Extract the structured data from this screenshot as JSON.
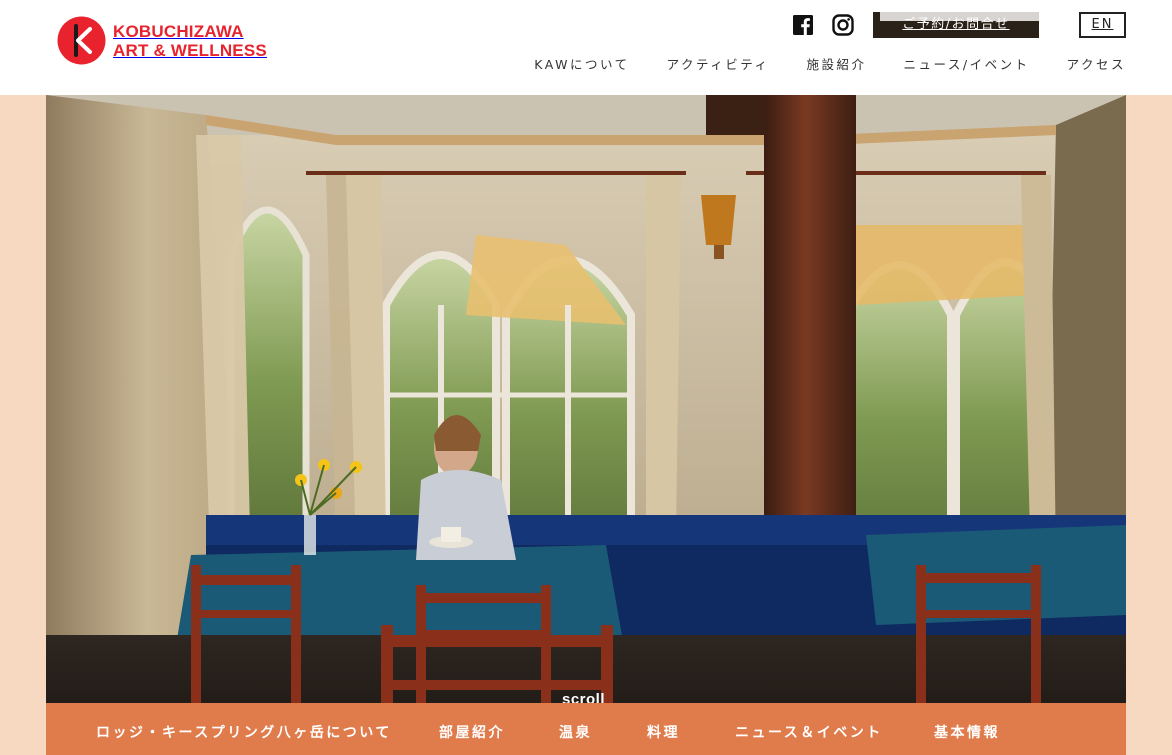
{
  "brand": {
    "line1": "KOBUCHIZAWA",
    "line2": "ART & WELLNESS",
    "accent_color": "#e8232d"
  },
  "header": {
    "social_icons": [
      "facebook-icon",
      "instagram-icon"
    ],
    "reserve_label": "ご予約/お問合せ",
    "lang_label": "EN",
    "nav": [
      {
        "label": "KAWについて"
      },
      {
        "label": "アクティビティ"
      },
      {
        "label": "施設紹介"
      },
      {
        "label": "ニュース/イベント"
      },
      {
        "label": "アクセス"
      }
    ]
  },
  "hero": {
    "scroll_label": "scroll"
  },
  "subnav": {
    "background_color": "#e07b4b",
    "items": [
      {
        "label": "ロッジ・キースプリング八ヶ岳について"
      },
      {
        "label": "部屋紹介"
      },
      {
        "label": "温泉"
      },
      {
        "label": "料理"
      },
      {
        "label": "ニュース＆イベント"
      },
      {
        "label": "基本情報"
      }
    ]
  },
  "page": {
    "background_color": "#f6d9c0"
  }
}
